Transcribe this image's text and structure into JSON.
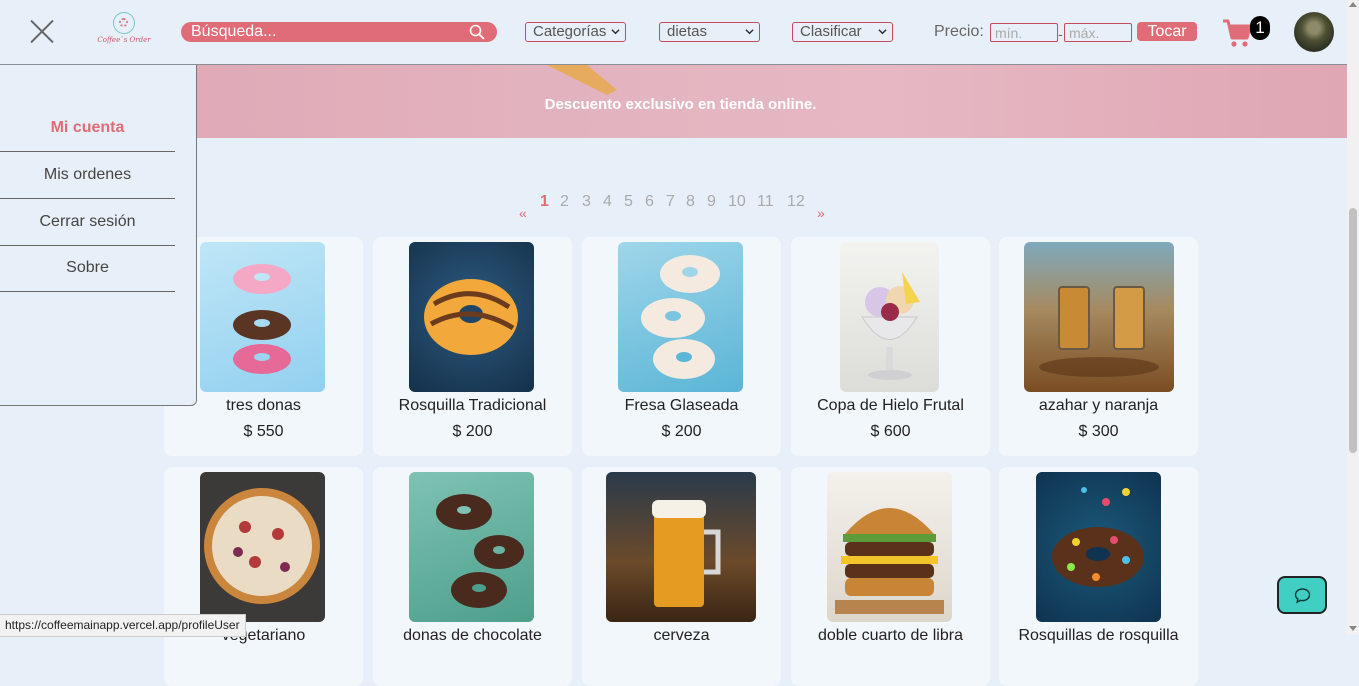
{
  "header": {
    "logo_text": "Coffee`s Order",
    "search_placeholder": "Búsqueda...",
    "categories_label": "Categorías",
    "diets_label": "dietas",
    "sort_label": "Clasificar",
    "price_label": "Precio:",
    "price_min_placeholder": "mín.",
    "price_dash": "-",
    "price_max_placeholder": "máx.",
    "submit_label": "Tocar",
    "cart_count": "1"
  },
  "banner": {
    "text": "Descuento exclusivo en tienda online."
  },
  "sidebar": {
    "items": [
      {
        "label": "Mi cuenta",
        "active": true
      },
      {
        "label": "Mis ordenes"
      },
      {
        "label": "Cerrar sesión"
      },
      {
        "label": "Sobre"
      }
    ]
  },
  "pagination": {
    "prev": "«",
    "next": "»",
    "pages": [
      "1",
      "2",
      "3",
      "4",
      "5",
      "6",
      "7",
      "8",
      "9",
      "10",
      "11",
      "12"
    ],
    "current": "1"
  },
  "products": [
    {
      "name": "tres donas",
      "price": "$ 550",
      "icon": "donut-stack-image"
    },
    {
      "name": "Rosquilla Tradicional",
      "price": "$ 200",
      "icon": "glazed-donut-image"
    },
    {
      "name": "Fresa Glaseada",
      "price": "$ 200",
      "icon": "sprinkle-donuts-image"
    },
    {
      "name": "Copa de Hielo Frutal",
      "price": "$ 600",
      "icon": "ice-cream-cup-image"
    },
    {
      "name": "azahar y naranja",
      "price": "$ 300",
      "icon": "tea-glasses-image"
    },
    {
      "name": "vegetariano",
      "price": "",
      "icon": "pizza-image"
    },
    {
      "name": "donas de chocolate",
      "price": "",
      "icon": "chocolate-donuts-image"
    },
    {
      "name": "cerveza",
      "price": "",
      "icon": "beer-image"
    },
    {
      "name": "doble cuarto de libra",
      "price": "",
      "icon": "burger-image"
    },
    {
      "name": "Rosquillas de rosquilla",
      "price": "",
      "icon": "candy-donut-image"
    }
  ],
  "status_url": "https://coffeemainapp.vercel.app/profileUser",
  "colors": {
    "accent": "#e06c77",
    "background": "#e7f0f8",
    "chat": "#41cfc3"
  }
}
